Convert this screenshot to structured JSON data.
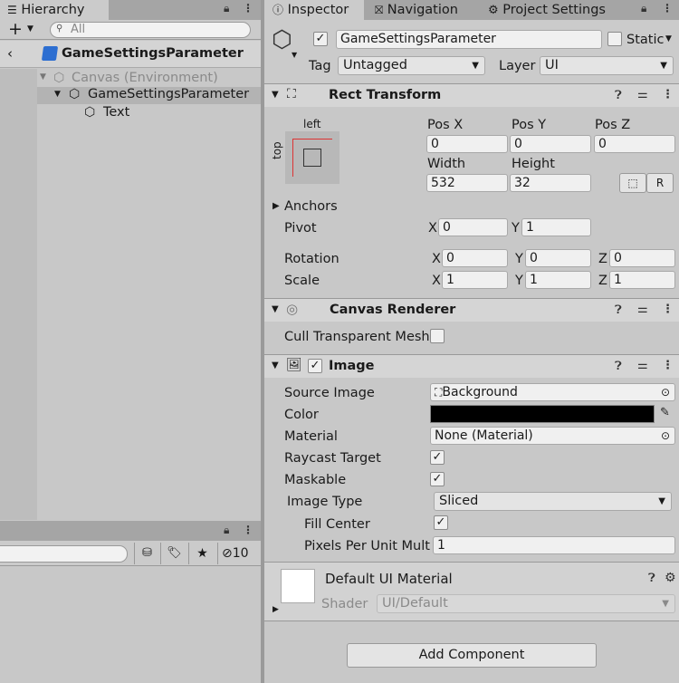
{
  "hierarchy": {
    "tab_label": "Hierarchy",
    "add_label": "+",
    "search_placeholder": "All",
    "scene_title": "GameSettingsParameter",
    "tree": [
      {
        "label": "Canvas (Environment)"
      },
      {
        "label": "GameSettingsParameter"
      },
      {
        "label": "Text"
      }
    ]
  },
  "bottom_panel": {
    "hidden_count": "10"
  },
  "tabs": {
    "inspector": "Inspector",
    "navigation": "Navigation",
    "project_settings": "Project Settings"
  },
  "object": {
    "name": "GameSettingsParameter",
    "static_label": "Static",
    "tag_label": "Tag",
    "tag_value": "Untagged",
    "layer_label": "Layer",
    "layer_value": "UI"
  },
  "rect_transform": {
    "title": "Rect Transform",
    "anchor_left": "left",
    "anchor_top": "top",
    "pos_x_label": "Pos X",
    "pos_y_label": "Pos Y",
    "pos_z_label": "Pos Z",
    "pos_x": "0",
    "pos_y": "0",
    "pos_z": "0",
    "width_label": "Width",
    "height_label": "Height",
    "width": "532",
    "height": "32",
    "raw_button": "R",
    "anchors_label": "Anchors",
    "pivot_label": "Pivot",
    "pivot_x": "0",
    "pivot_y": "1",
    "rotation_label": "Rotation",
    "rot_x": "0",
    "rot_y": "0",
    "rot_z": "0",
    "scale_label": "Scale",
    "scale_x": "1",
    "scale_y": "1",
    "scale_z": "1",
    "x": "X",
    "y": "Y",
    "z": "Z"
  },
  "canvas_renderer": {
    "title": "Canvas Renderer",
    "cull_label": "Cull Transparent Mesh"
  },
  "image": {
    "title": "Image",
    "source_image_label": "Source Image",
    "source_image_value": "Background",
    "color_label": "Color",
    "color_value": "#000000",
    "material_label": "Material",
    "material_value": "None (Material)",
    "raycast_label": "Raycast Target",
    "maskable_label": "Maskable",
    "image_type_label": "Image Type",
    "image_type_value": "Sliced",
    "fill_center_label": "Fill Center",
    "ppu_label": "Pixels Per Unit Multip",
    "ppu_value": "1"
  },
  "material_preview": {
    "title": "Default UI Material",
    "shader_label": "Shader",
    "shader_value": "UI/Default"
  },
  "add_component_label": "Add Component"
}
